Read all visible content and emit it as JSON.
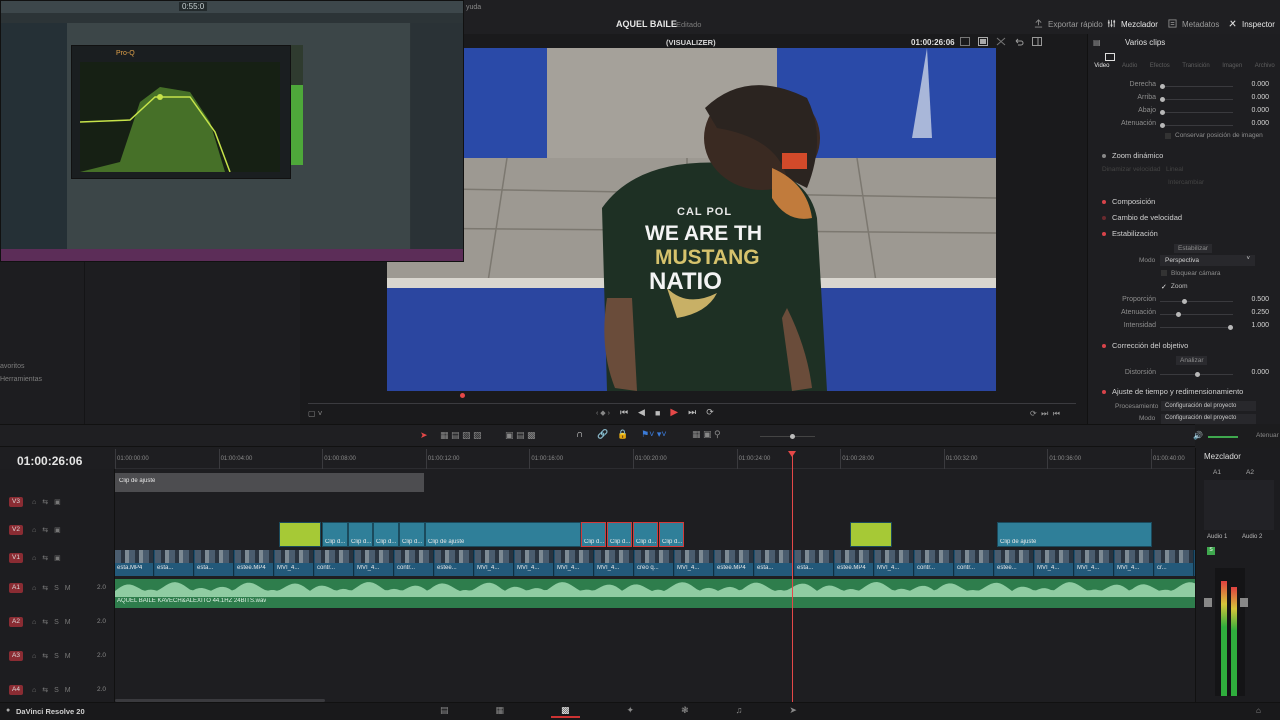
{
  "topbar": {
    "menu_fragment": "yuda",
    "project_title": "AQUEL BAILE",
    "project_status": "Editado",
    "buttons": [
      {
        "label": "Exportar rápido",
        "icon": "export-icon"
      },
      {
        "label": "Mezclador",
        "icon": "mixer-icon"
      },
      {
        "label": "Metadatos",
        "icon": "metadata-icon"
      },
      {
        "label": "Inspector",
        "icon": "inspector-icon"
      }
    ]
  },
  "viewer": {
    "title": "(VISUALIZER)",
    "timecode": "01:00:26:06",
    "playhead_progress": 0.2
  },
  "video_text": {
    "line1": "CAL POL",
    "line2": "WE ARE TH",
    "line3": "MUSTANG",
    "line4": "NATIO"
  },
  "inspector": {
    "title": "Varios clips",
    "tabs": [
      "Video",
      "Audio",
      "Efectos",
      "Transición",
      "Imagen",
      "Archivo"
    ],
    "crop_rows": [
      {
        "label": "Derecha",
        "value": "0.000"
      },
      {
        "label": "Arriba",
        "value": "0.000"
      },
      {
        "label": "Abajo",
        "value": "0.000"
      },
      {
        "label": "Atenuación",
        "value": "0.000"
      }
    ],
    "keep_position": "Conservar posición de imagen",
    "dynamic_zoom": "Zoom dinámico",
    "zoom_fields": [
      "Dinamizar velocidad",
      "Lineal",
      "Intercambiar"
    ],
    "composition": "Composición",
    "speed_change": "Cambio de velocidad",
    "stabilization": "Estabilización",
    "stabilize_btn": "Estabilizar",
    "mode_label": "Modo",
    "mode_value": "Perspectiva",
    "lock_camera": "Bloquear cámara",
    "zoom_check": "Zoom",
    "stab_rows": [
      {
        "label": "Proporción",
        "value": "0.500"
      },
      {
        "label": "Atenuación",
        "value": "0.250"
      },
      {
        "label": "Intensidad",
        "value": "1.000"
      }
    ],
    "lens_correction": "Corrección del objetivo",
    "analyze_btn": "Analizar",
    "distortion_label": "Distorsión",
    "distortion_value": "0.000",
    "retime": "Ajuste de tiempo y redimensionamiento",
    "processing_label": "Procesamiento",
    "processing_value": "Configuración del proyecto",
    "mode2_label": "Modo",
    "mode2_value": "Configuración del proyecto"
  },
  "left_panel": {
    "favorites": "avoritos",
    "tools": "Herramientas"
  },
  "timeline": {
    "timecode": "01:00:26:06",
    "ruler": [
      "01:00:00:00",
      "01:00:04:00",
      "01:00:08:00",
      "01:00:12:00",
      "01:00:16:00",
      "01:00:20:00",
      "01:00:24:00",
      "01:00:28:00",
      "01:00:32:00",
      "01:00:36:00",
      "01:00:40:00"
    ],
    "tracks": [
      {
        "id": "V3",
        "kind": "video"
      },
      {
        "id": "V2",
        "kind": "video"
      },
      {
        "id": "V1",
        "kind": "video"
      },
      {
        "id": "A1",
        "kind": "audio",
        "level": "2.0"
      },
      {
        "id": "A2",
        "kind": "audio",
        "level": "2.0"
      },
      {
        "id": "A3",
        "kind": "audio",
        "level": "2.0"
      },
      {
        "id": "A4",
        "kind": "audio",
        "level": "2.0"
      }
    ],
    "adjustment_clip": "Clip de ajuste",
    "v2_clips": [
      "Clip d...",
      "Clip d...",
      "Clip d...",
      "Clip d...",
      "Clip de ajuste",
      "Clip d...",
      "Clip d...",
      "Clip d...",
      "Clip d...",
      "Clip de ajuste"
    ],
    "v1_clips": [
      "esta.MP4",
      "esta...",
      "esta...",
      "estee.MP4",
      "MVI_4...",
      "contr...",
      "MVI_4...",
      "contr...",
      "estee...",
      "MVI_4...",
      "MVI_4...",
      "MVI_4...",
      "MVI_4...",
      "creo q...",
      "MVI_4...",
      "estee.MP4",
      "esta...",
      "esta...",
      "estee.MP4",
      "MVI_4...",
      "contr...",
      "contr...",
      "estee...",
      "MVI_4...",
      "MVI_4...",
      "MVI_4...",
      "cr..."
    ],
    "audio_clip": "AQUEL BAILE KAVECH&ALEXITO 44.1HZ 24BITS.wav",
    "volume_label": "Atenuar"
  },
  "mixer": {
    "title": "Mezclador",
    "channels": [
      "A1",
      "A2"
    ],
    "bus_labels": [
      "Audio 1",
      "Audio 2"
    ],
    "meter_levels": [
      0.9,
      0.85
    ]
  },
  "statusbar": {
    "app_name": "DaVinci Resolve 20"
  },
  "fl_studio": {
    "plugin_name": "Pro-Q",
    "time": "0:55:0"
  }
}
